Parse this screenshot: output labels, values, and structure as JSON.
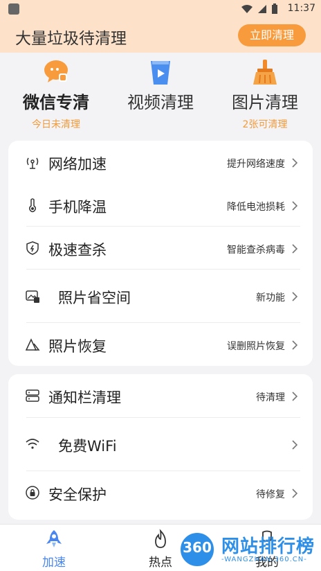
{
  "status_bar": {
    "time": "11:37"
  },
  "header": {
    "title": "大量垃圾待清理",
    "action": "立即清理"
  },
  "top_tools": [
    {
      "name": "微信专清",
      "sub": "今日未清理",
      "icon": "wechat-icon"
    },
    {
      "name": "视频清理",
      "sub": "",
      "icon": "video-icon"
    },
    {
      "name": "图片清理",
      "sub": "2张可清理",
      "icon": "broom-icon"
    }
  ],
  "features_a": [
    {
      "label": "网络加速",
      "right": "提升网络速度",
      "icon": "signal-icon"
    },
    {
      "label": "手机降温",
      "right": "降低电池损耗",
      "icon": "thermometer-icon"
    },
    {
      "label": "极速查杀",
      "right": "智能查杀病毒",
      "icon": "shield-icon"
    },
    {
      "label": "照片省空间",
      "right": "新功能",
      "icon": "photo-compress-icon"
    },
    {
      "label": "照片恢复",
      "right": "误删照片恢复",
      "icon": "photo-restore-icon"
    }
  ],
  "features_b": [
    {
      "label": "通知栏清理",
      "right": "待清理",
      "icon": "notification-icon"
    },
    {
      "label": "免费WiFi",
      "right": "",
      "icon": "wifi-icon"
    },
    {
      "label": "安全保护",
      "right": "待修复",
      "icon": "lock-icon"
    }
  ],
  "bottom_nav": [
    {
      "label": "加速",
      "icon": "rocket-icon",
      "active": true
    },
    {
      "label": "热点",
      "icon": "flame-icon",
      "active": false
    },
    {
      "label": "我的",
      "icon": "profile-icon",
      "active": false
    }
  ],
  "watermark": {
    "logo": "360",
    "title": "网站排行榜",
    "url": "-WANGZHAN.360.CN-"
  },
  "colors": {
    "accent": "#f79b3c",
    "header_bg": "#fde1c8",
    "nav_active": "#4a86f0"
  }
}
